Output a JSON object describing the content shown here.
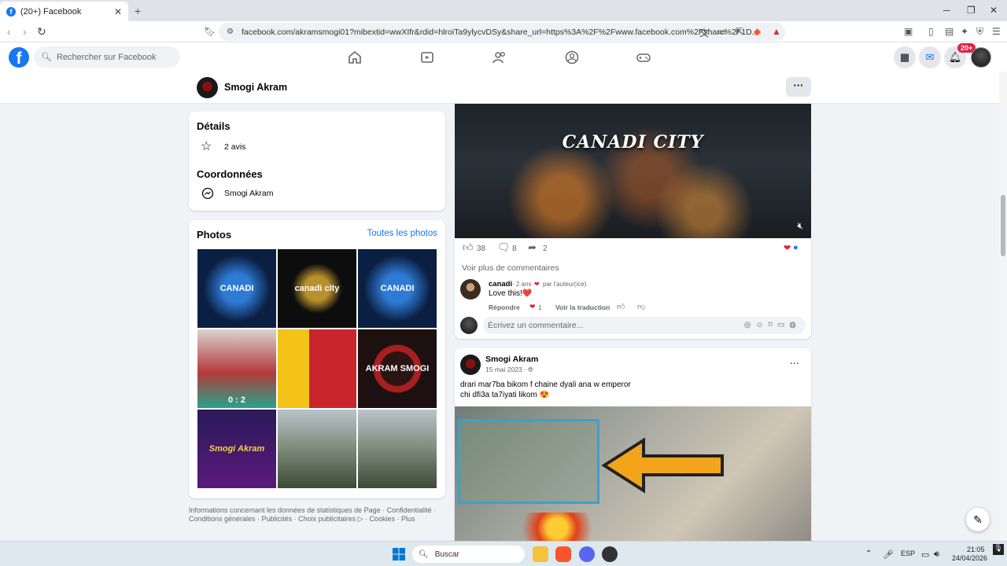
{
  "browser": {
    "tab_title": "(20+) Facebook",
    "tab_favicon": "f",
    "tab_close": "✕",
    "new_tab": "+",
    "url": "facebook.com/akramsmogi01?mibextid=wwXIfr&rdid=hlroiTa9ylycvDSy&share_url=https%3A%2F%2Fwww.facebook.com%2Fshare%2F1D..."
  },
  "fb": {
    "logo": "f",
    "search_placeholder": "Rechercher sur Facebook",
    "notif_badge": "20+"
  },
  "page": {
    "name": "Smogi Akram",
    "more": "···"
  },
  "details": {
    "title": "Détails",
    "reviews": "2 avis",
    "contact_title": "Coordonnées",
    "messenger": "Smogi Akram"
  },
  "photos": {
    "title": "Photos",
    "see_all": "Toutes les photos",
    "items": [
      {
        "caption": "CANADI",
        "bg": "#0f2a56"
      },
      {
        "caption": "canadi city",
        "bg": "#0d0d0d"
      },
      {
        "caption": "CANADI",
        "bg": "#0f2a56"
      },
      {
        "caption": "0 : 2",
        "bg": "#b43a3a"
      },
      {
        "caption": "",
        "bg": "#c8262c"
      },
      {
        "caption": "AKRAM SMOGI",
        "bg": "#1c1010"
      },
      {
        "caption": "Smogi Akram",
        "bg": "#3a1a6a"
      },
      {
        "caption": "",
        "bg": "#7d8b7a"
      },
      {
        "caption": "",
        "bg": "#7d8b7a"
      }
    ]
  },
  "footer": {
    "line1": "Informations concernant les données de statistiques de Page · Confidentialité ·",
    "line2": "Conditions générales · Publicités · Choix publicitaires ▷ · Cookies · Plus"
  },
  "post1": {
    "video_title": "CANADI CITY",
    "likes": "38",
    "comments": "8",
    "shares": "2",
    "see_more_comments": "Voir plus de commentaires",
    "comment": {
      "author": "canadi",
      "meta": "· 2 ans ·",
      "author_badge": "par l'auteur(ice)",
      "text": "Love this!❤️",
      "reply": "Répondre",
      "reactions": "1",
      "translate": "Voir la traduction"
    },
    "write_comment_placeholder": "Écrivez un commentaire..."
  },
  "post2": {
    "author": "Smogi Akram",
    "date": "15 mai 2023 ·",
    "more": "···",
    "text_line1": "drari mar7ba bikom f chaine dyali ana w emperor",
    "text_line2": "chi dfi3a ta7iyati likom 😍"
  },
  "taskbar": {
    "search_placeholder": "Buscar",
    "lang": "ESP",
    "time": "21:05",
    "date": "24/04/2026"
  }
}
